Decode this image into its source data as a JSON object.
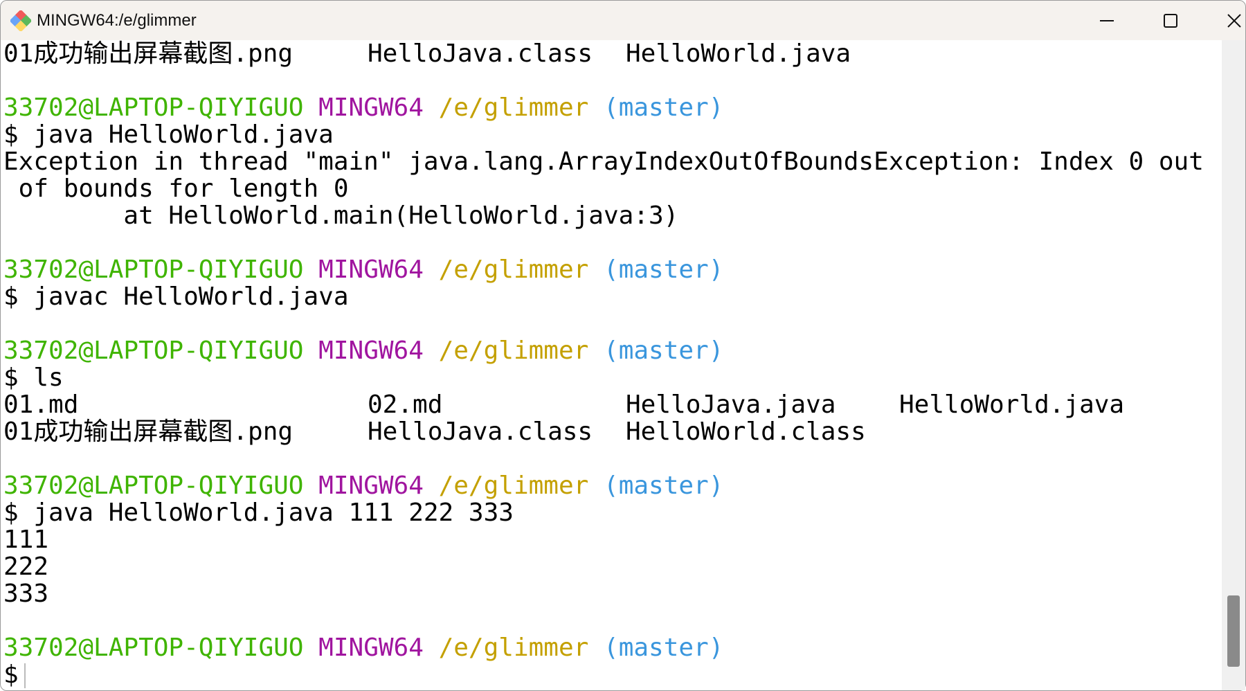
{
  "window": {
    "title": "MINGW64:/e/glimmer",
    "app_icon": "git-bash-icon",
    "controls": [
      "minimize-icon",
      "maximize-icon",
      "close-icon"
    ]
  },
  "prompt": {
    "user": "33702@LAPTOP-QIYIGUO",
    "system": "MINGW64",
    "path": "/e/glimmer",
    "branch": "(master)"
  },
  "colors": {
    "user": "#3fb400",
    "system": "#a0159f",
    "path": "#c4a000",
    "branch": "#3a96dd"
  },
  "terminal": {
    "top_ls": [
      "01成功输出屏幕截图.png",
      "HelloJava.class",
      "HelloWorld.java"
    ],
    "cmd1": "$ java HelloWorld.java",
    "err1": "Exception in thread \"main\" java.lang.ArrayIndexOutOfBoundsException: Index 0 out",
    "err2": " of bounds for length 0",
    "err3": "        at HelloWorld.main(HelloWorld.java:3)",
    "cmd2": "$ javac HelloWorld.java",
    "cmd3": "$ ls",
    "ls_row1": [
      "01.md",
      "02.md",
      "HelloJava.java",
      "HelloWorld.java"
    ],
    "ls_row2": [
      "01成功输出屏幕截图.png",
      "HelloJava.class",
      "HelloWorld.class"
    ],
    "cmd4": "$ java HelloWorld.java 111 222 333",
    "out": [
      "111",
      "222",
      "333"
    ],
    "final_prompt": "$"
  }
}
